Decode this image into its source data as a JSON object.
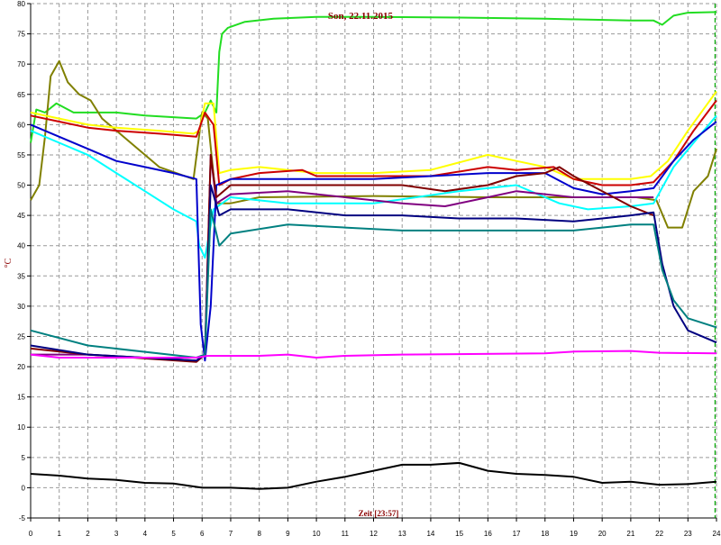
{
  "chart_data": {
    "type": "line",
    "title": "Son, 22.11.2015",
    "xlabel": "Zeit [23:57]",
    "ylabel": "°C",
    "xlim": [
      0,
      24
    ],
    "ylim": [
      -5,
      80
    ],
    "x_ticks": [
      0,
      1,
      2,
      3,
      4,
      5,
      6,
      7,
      8,
      9,
      10,
      11,
      12,
      13,
      14,
      15,
      16,
      17,
      18,
      19,
      20,
      21,
      22,
      23,
      24
    ],
    "x_tick_labels": [
      "0",
      "1",
      "2",
      "3",
      "4",
      "5",
      "6",
      "7",
      "8",
      "9",
      "10",
      "11",
      "12",
      "13",
      "14",
      "15",
      "16",
      "17",
      "18",
      "19",
      "20",
      "21",
      "22",
      "23",
      "24"
    ],
    "y_ticks": [
      -5,
      0,
      5,
      10,
      15,
      20,
      25,
      30,
      35,
      40,
      45,
      50,
      55,
      60,
      65,
      70,
      75,
      80
    ],
    "y_tick_labels": [
      "-5",
      "0",
      "5",
      "10",
      "15",
      "20",
      "25",
      "30",
      "35",
      "40",
      "45",
      "50",
      "55",
      "60",
      "65",
      "70",
      "75",
      "80"
    ],
    "grid": true,
    "current_time_marker": 23.95,
    "series": [
      {
        "color": "#22dd22",
        "points": [
          [
            0,
            57
          ],
          [
            0.2,
            62.5
          ],
          [
            0.5,
            62
          ],
          [
            0.9,
            63.5
          ],
          [
            1.5,
            62
          ],
          [
            3,
            62
          ],
          [
            4,
            61.5
          ],
          [
            5.8,
            61
          ],
          [
            6.1,
            62
          ],
          [
            6.3,
            64
          ],
          [
            6.5,
            62
          ],
          [
            6.6,
            72
          ],
          [
            6.7,
            75
          ],
          [
            6.9,
            76
          ],
          [
            7.5,
            77
          ],
          [
            8.5,
            77.5
          ],
          [
            10,
            77.8
          ],
          [
            12,
            77.8
          ],
          [
            15,
            77.7
          ],
          [
            18,
            77.5
          ],
          [
            21,
            77.2
          ],
          [
            21.8,
            77.2
          ],
          [
            22.1,
            76.5
          ],
          [
            22.5,
            78
          ],
          [
            23,
            78.5
          ],
          [
            24,
            78.6
          ]
        ]
      },
      {
        "color": "#808000",
        "points": [
          [
            0,
            47.5
          ],
          [
            0.3,
            50
          ],
          [
            0.5,
            58
          ],
          [
            0.7,
            68
          ],
          [
            1,
            70.5
          ],
          [
            1.3,
            67
          ],
          [
            1.7,
            65
          ],
          [
            2.1,
            64
          ],
          [
            2.5,
            61
          ],
          [
            3.5,
            57
          ],
          [
            4.5,
            53
          ],
          [
            5.7,
            51
          ],
          [
            6,
            62
          ],
          [
            6.2,
            61
          ],
          [
            6.5,
            47
          ],
          [
            7,
            47
          ],
          [
            8,
            48
          ],
          [
            12,
            48.2
          ],
          [
            16,
            48
          ],
          [
            20,
            48
          ],
          [
            21.2,
            48
          ],
          [
            21.9,
            47.5
          ],
          [
            22.3,
            43
          ],
          [
            22.8,
            43
          ],
          [
            23.2,
            49
          ],
          [
            23.7,
            51.5
          ],
          [
            24,
            56
          ]
        ]
      },
      {
        "color": "#ffff00",
        "points": [
          [
            0,
            62
          ],
          [
            1,
            61
          ],
          [
            2,
            60
          ],
          [
            3,
            59.5
          ],
          [
            4.5,
            59
          ],
          [
            5.7,
            58.5
          ],
          [
            5.9,
            59
          ],
          [
            6.1,
            63.5
          ],
          [
            6.4,
            63.5
          ],
          [
            6.6,
            52
          ],
          [
            7,
            52.5
          ],
          [
            8,
            53
          ],
          [
            10,
            52
          ],
          [
            12,
            52
          ],
          [
            14,
            52.5
          ],
          [
            16,
            55
          ],
          [
            17,
            54
          ],
          [
            18,
            53
          ],
          [
            19,
            51
          ],
          [
            20,
            51
          ],
          [
            21,
            51
          ],
          [
            21.7,
            51.5
          ],
          [
            22.3,
            54
          ],
          [
            23,
            59
          ],
          [
            24,
            65.5
          ]
        ]
      },
      {
        "color": "#cc0000",
        "points": [
          [
            0,
            61.5
          ],
          [
            1,
            60.5
          ],
          [
            2,
            59.5
          ],
          [
            3,
            59
          ],
          [
            4.5,
            58.5
          ],
          [
            5.8,
            58
          ],
          [
            6.1,
            62
          ],
          [
            6.4,
            60
          ],
          [
            6.6,
            50
          ],
          [
            7,
            51
          ],
          [
            8,
            52
          ],
          [
            9.5,
            52.5
          ],
          [
            10,
            51.5
          ],
          [
            12,
            51.5
          ],
          [
            14,
            51.5
          ],
          [
            16,
            53
          ],
          [
            17,
            52.5
          ],
          [
            18.3,
            53
          ],
          [
            19,
            51
          ],
          [
            20,
            50
          ],
          [
            21,
            50
          ],
          [
            21.8,
            50.5
          ],
          [
            22.5,
            54
          ],
          [
            23.2,
            59
          ],
          [
            24,
            64
          ]
        ]
      },
      {
        "color": "#00ffff",
        "points": [
          [
            0,
            59
          ],
          [
            1,
            57
          ],
          [
            2,
            55
          ],
          [
            3,
            52
          ],
          [
            4,
            49
          ],
          [
            5,
            46
          ],
          [
            5.8,
            44
          ],
          [
            5.9,
            40
          ],
          [
            6.1,
            38
          ],
          [
            6.4,
            46
          ],
          [
            7,
            48
          ],
          [
            9,
            47
          ],
          [
            12,
            47
          ],
          [
            15,
            49
          ],
          [
            17,
            50
          ],
          [
            18.5,
            47
          ],
          [
            19.5,
            46
          ],
          [
            21,
            46.5
          ],
          [
            21.8,
            47
          ],
          [
            22.5,
            53
          ],
          [
            23.2,
            57
          ],
          [
            24,
            61.5
          ]
        ]
      },
      {
        "color": "#0000cc",
        "points": [
          [
            0,
            60
          ],
          [
            1,
            58
          ],
          [
            2,
            56
          ],
          [
            3,
            54
          ],
          [
            4,
            53
          ],
          [
            5,
            52
          ],
          [
            5.8,
            51
          ],
          [
            5.95,
            27
          ],
          [
            6.1,
            21
          ],
          [
            6.3,
            30
          ],
          [
            6.5,
            50
          ],
          [
            7,
            51
          ],
          [
            10,
            51
          ],
          [
            12,
            51
          ],
          [
            14,
            51.5
          ],
          [
            16,
            52
          ],
          [
            18,
            52
          ],
          [
            19,
            49.5
          ],
          [
            20,
            48.5
          ],
          [
            21,
            49
          ],
          [
            21.8,
            49.5
          ],
          [
            22.5,
            54
          ],
          [
            23.2,
            57.5
          ],
          [
            24,
            60.5
          ]
        ]
      },
      {
        "color": "#800080",
        "points": [
          [
            0,
            22
          ],
          [
            2,
            22
          ],
          [
            5.8,
            21
          ],
          [
            6.1,
            22
          ],
          [
            6.3,
            55
          ],
          [
            6.5,
            47
          ],
          [
            7,
            48.5
          ],
          [
            9,
            49
          ],
          [
            11,
            48
          ],
          [
            13,
            47
          ],
          [
            14.5,
            46.5
          ],
          [
            16,
            48
          ],
          [
            17,
            49
          ],
          [
            18,
            48.5
          ],
          [
            19,
            48
          ],
          [
            20,
            48
          ],
          [
            21,
            48
          ],
          [
            21.8,
            48
          ]
        ]
      },
      {
        "color": "#800000",
        "points": [
          [
            0,
            23
          ],
          [
            2,
            22
          ],
          [
            5.8,
            20.8
          ],
          [
            6.1,
            22
          ],
          [
            6.3,
            55
          ],
          [
            6.5,
            48
          ],
          [
            7,
            50
          ],
          [
            9,
            50
          ],
          [
            11,
            50
          ],
          [
            13,
            50
          ],
          [
            14.5,
            49
          ],
          [
            16,
            50
          ],
          [
            17,
            51.5
          ],
          [
            18,
            52
          ],
          [
            18.5,
            53
          ],
          [
            19,
            51.5
          ],
          [
            20,
            49
          ],
          [
            21,
            46.5
          ],
          [
            21.8,
            45
          ]
        ]
      },
      {
        "color": "#000080",
        "points": [
          [
            0,
            23.5
          ],
          [
            2,
            22
          ],
          [
            5.8,
            21
          ],
          [
            6.1,
            22
          ],
          [
            6.3,
            50
          ],
          [
            6.6,
            45
          ],
          [
            7,
            46
          ],
          [
            9,
            46
          ],
          [
            11,
            45
          ],
          [
            13,
            45
          ],
          [
            15,
            44.5
          ],
          [
            17,
            44.5
          ],
          [
            19,
            44
          ],
          [
            20,
            44.5
          ],
          [
            21,
            45
          ],
          [
            21.8,
            45.5
          ],
          [
            22.1,
            37
          ],
          [
            22.5,
            30
          ],
          [
            23,
            26
          ],
          [
            24,
            24
          ]
        ]
      },
      {
        "color": "#008080",
        "points": [
          [
            0,
            26
          ],
          [
            2,
            23.5
          ],
          [
            5.8,
            21.5
          ],
          [
            6.1,
            22
          ],
          [
            6.3,
            46
          ],
          [
            6.6,
            40
          ],
          [
            7,
            42
          ],
          [
            9,
            43.5
          ],
          [
            11,
            43
          ],
          [
            13,
            42.5
          ],
          [
            15,
            42.5
          ],
          [
            17,
            42.5
          ],
          [
            19,
            42.5
          ],
          [
            20,
            43
          ],
          [
            21,
            43.5
          ],
          [
            21.8,
            43.5
          ],
          [
            22.1,
            36
          ],
          [
            22.5,
            31
          ],
          [
            23,
            28
          ],
          [
            24,
            26.5
          ]
        ]
      },
      {
        "color": "#ff00ff",
        "points": [
          [
            0,
            22
          ],
          [
            1,
            21.5
          ],
          [
            3,
            21.5
          ],
          [
            5.8,
            21.5
          ],
          [
            6.2,
            21.8
          ],
          [
            8,
            21.8
          ],
          [
            9,
            22
          ],
          [
            10,
            21.5
          ],
          [
            11,
            21.8
          ],
          [
            13,
            22
          ],
          [
            18,
            22.2
          ],
          [
            19,
            22.5
          ],
          [
            21,
            22.6
          ],
          [
            22,
            22.3
          ],
          [
            24,
            22.2
          ]
        ]
      },
      {
        "color": "#000000",
        "points": [
          [
            0,
            2.3
          ],
          [
            1,
            2
          ],
          [
            2,
            1.5
          ],
          [
            3,
            1.3
          ],
          [
            4,
            0.8
          ],
          [
            5,
            0.7
          ],
          [
            6,
            0
          ],
          [
            7,
            0
          ],
          [
            8,
            -0.2
          ],
          [
            9,
            0
          ],
          [
            10,
            1
          ],
          [
            11,
            1.8
          ],
          [
            12,
            2.8
          ],
          [
            13,
            3.8
          ],
          [
            14,
            3.8
          ],
          [
            15,
            4.1
          ],
          [
            16,
            2.8
          ],
          [
            17,
            2.3
          ],
          [
            18,
            2.1
          ],
          [
            19,
            1.8
          ],
          [
            20,
            0.8
          ],
          [
            21,
            1
          ],
          [
            22,
            0.5
          ],
          [
            23,
            0.6
          ],
          [
            24,
            1
          ]
        ]
      }
    ]
  }
}
